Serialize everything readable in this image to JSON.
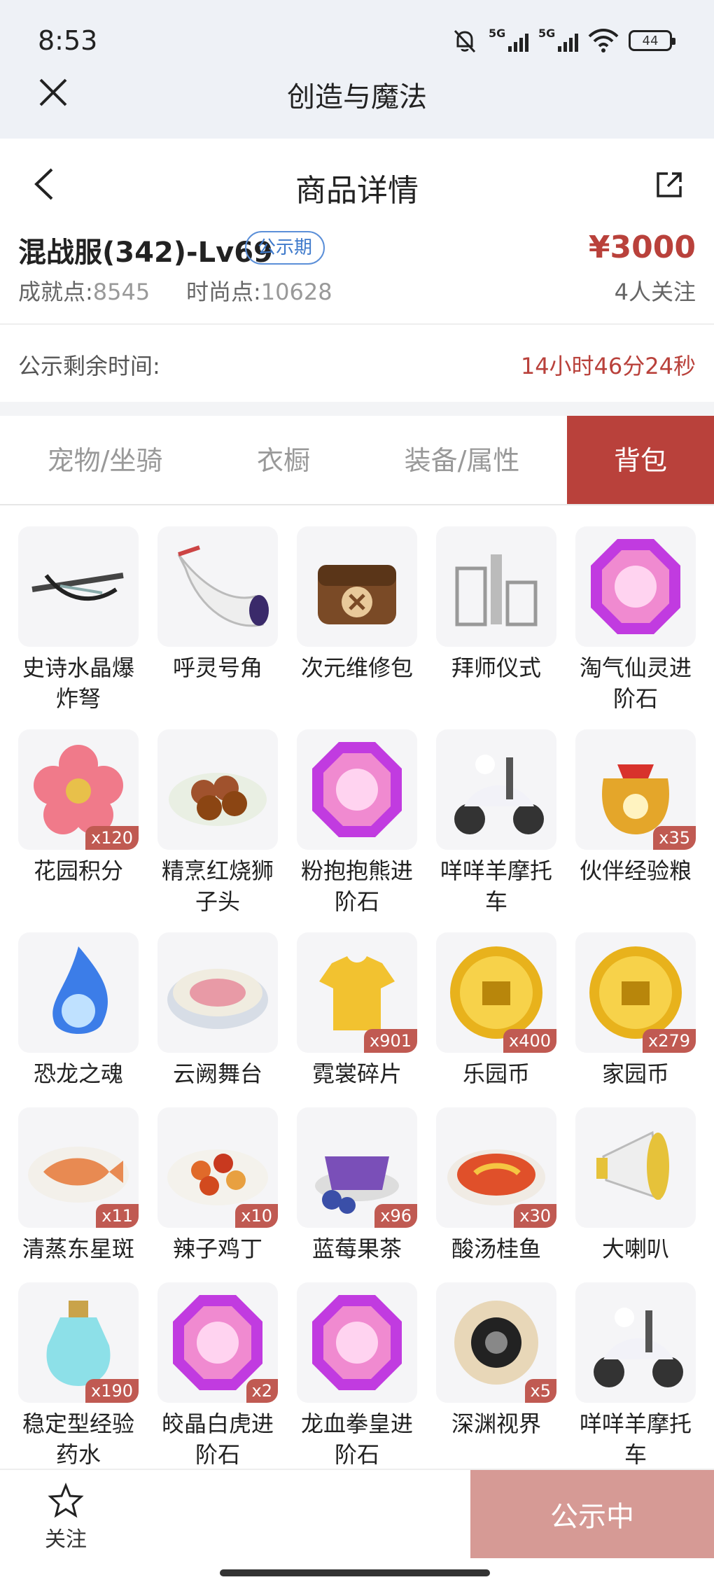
{
  "status_bar": {
    "time": "8:53",
    "net1": "5G",
    "net2": "5G",
    "battery": "44"
  },
  "app_bar": {
    "title": "创造与魔法"
  },
  "header": {
    "title": "商品详情"
  },
  "listing": {
    "server": "混战服(342)-Lv69",
    "badge": "公示期",
    "price": "¥3000",
    "achievement_label": "成就点:",
    "achievement_value": "8545",
    "fashion_label": "时尚点:",
    "fashion_value": "10628",
    "followers": "4人关注"
  },
  "countdown": {
    "label": "公示剩余时间:",
    "value": "14小时46分24秒"
  },
  "tabs": [
    {
      "label": "宠物/坐骑"
    },
    {
      "label": "衣橱"
    },
    {
      "label": "装备/属性"
    },
    {
      "label": "背包"
    }
  ],
  "items": [
    {
      "name": "史诗水晶爆炸弩",
      "qty": "",
      "icon": "crossbow-icon"
    },
    {
      "name": "呼灵号角",
      "qty": "",
      "icon": "horn-icon"
    },
    {
      "name": "次元维修包",
      "qty": "",
      "icon": "repair-bag-icon"
    },
    {
      "name": "拜师仪式",
      "qty": "",
      "icon": "ceremony-icon"
    },
    {
      "name": "淘气仙灵进阶石",
      "qty": "",
      "icon": "gem-icon"
    },
    {
      "name": "花园积分",
      "qty": "x120",
      "icon": "flower-icon"
    },
    {
      "name": "精烹红烧狮子头",
      "qty": "",
      "icon": "meatball-dish-icon"
    },
    {
      "name": "粉抱抱熊进阶石",
      "qty": "",
      "icon": "gem-icon"
    },
    {
      "name": "咩咩羊摩托车",
      "qty": "",
      "icon": "scooter-icon"
    },
    {
      "name": "伙伴经验粮",
      "qty": "x35",
      "icon": "food-bag-icon"
    },
    {
      "name": "恐龙之魂",
      "qty": "",
      "icon": "blue-flame-icon"
    },
    {
      "name": "云阙舞台",
      "qty": "",
      "icon": "stage-icon"
    },
    {
      "name": "霓裳碎片",
      "qty": "x901",
      "icon": "shirt-icon"
    },
    {
      "name": "乐园币",
      "qty": "x400",
      "icon": "gold-coin-icon"
    },
    {
      "name": "家园币",
      "qty": "x279",
      "icon": "gold-coin-icon"
    },
    {
      "name": "清蒸东星斑",
      "qty": "x11",
      "icon": "fish-dish-icon"
    },
    {
      "name": "辣子鸡丁",
      "qty": "x10",
      "icon": "chicken-dish-icon"
    },
    {
      "name": "蓝莓果茶",
      "qty": "x96",
      "icon": "tea-icon"
    },
    {
      "name": "酸汤桂鱼",
      "qty": "x30",
      "icon": "soup-icon"
    },
    {
      "name": "大喇叭",
      "qty": "",
      "icon": "megaphone-icon"
    },
    {
      "name": "稳定型经验药水",
      "qty": "x190",
      "icon": "potion-icon"
    },
    {
      "name": "皎晶白虎进阶石",
      "qty": "x2",
      "icon": "gem-icon"
    },
    {
      "name": "龙血拳皇进阶石",
      "qty": "",
      "icon": "gem-icon"
    },
    {
      "name": "深渊视界",
      "qty": "x5",
      "icon": "abyss-icon"
    },
    {
      "name": "咩咩羊摩托车",
      "qty": "",
      "icon": "scooter-icon"
    }
  ],
  "bottom_bar": {
    "follow_label": "关注",
    "status_button": "公示中"
  },
  "colors": {
    "accent": "#b9413b",
    "link": "#3f7acb",
    "qty_badge": "#c05a52",
    "status_button": "#d69a95"
  }
}
